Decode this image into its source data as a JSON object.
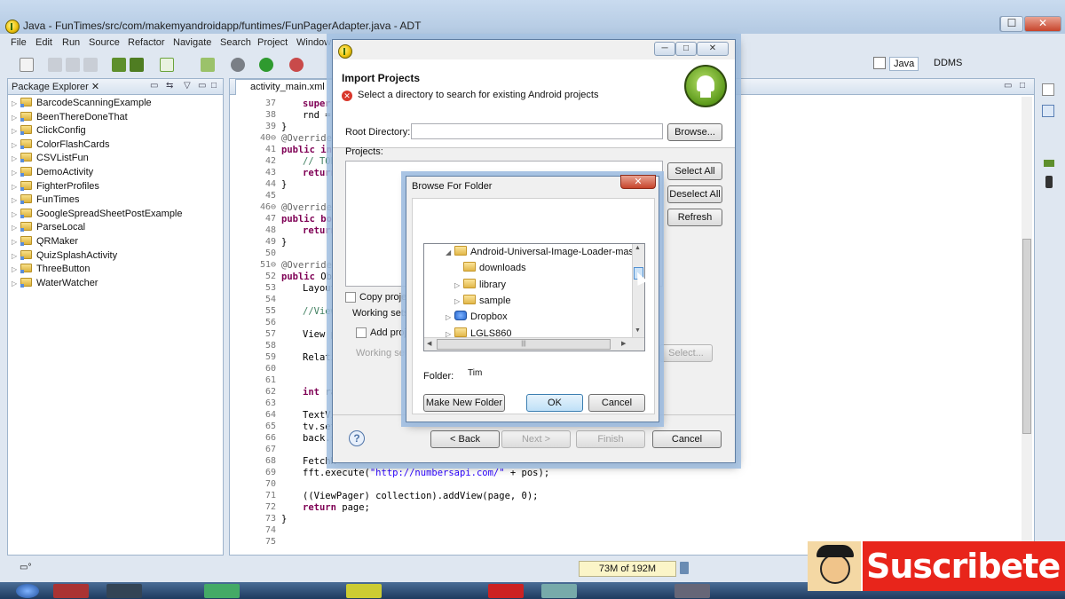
{
  "window": {
    "title": "Java - FunTimes/src/com/makemyandroidapp/funtimes/FunPagerAdapter.java - ADT",
    "controls": [
      "─",
      "☐",
      "✕"
    ]
  },
  "menu": [
    "File",
    "Edit",
    "Run",
    "Source",
    "Refactor",
    "Navigate",
    "Search",
    "Project",
    "Window"
  ],
  "perspectives": {
    "java": "Java",
    "ddms": "DDMS"
  },
  "package_explorer": {
    "title": "Package Explorer ✕",
    "projects": [
      "BarcodeScanningExample",
      "BeenThereDoneThat",
      "ClickConfig",
      "ColorFlashCards",
      "CSVListFun",
      "DemoActivity",
      "FighterProfiles",
      "FunTimes",
      "GoogleSpreadSheetPostExample",
      "ParseLocal",
      "QRMaker",
      "QuizSplashActivity",
      "ThreeButton",
      "WaterWatcher"
    ]
  },
  "editor": {
    "tab": "activity_main.xml",
    "line_numbers": [
      "37",
      "38",
      "39",
      "40⊖",
      "41",
      "42",
      "43",
      "44",
      "45",
      "46⊖",
      "47",
      "48",
      "49",
      "50",
      "51⊖",
      "52",
      "53",
      "54",
      "55",
      "56",
      "57",
      "58",
      "59",
      "60",
      "61",
      "62",
      "63",
      "64",
      "65",
      "66",
      "67",
      "68",
      "69",
      "70",
      "71",
      "72",
      "73",
      "74",
      "75"
    ],
    "lines": {
      "l37": "super",
      "l38": "rnd =",
      "l39": "}",
      "l40": "@Override",
      "l41a": "public",
      "l41b": " int",
      "l42": "// TOD",
      "l43": "return",
      "l44": "}",
      "l46": "@Override",
      "l47a": "public",
      "l47b": " boo",
      "l48": "return",
      "l49": "}",
      "l51": "@Override",
      "l52a": "public",
      "l52b": " Ob",
      "l53": "Layout",
      "l55": "//View",
      "l57": "View p",
      "l59": "Relati",
      "l62a": "int",
      "l62b": " ra",
      "l64": "TextVi",
      "l65": "tv.set",
      "l66": "back.s",
      "l68": "FetchN",
      "l69a": "fft.execute(",
      "l69b": "\"http://numbersapi.com/\"",
      "l69c": " + pos);",
      "l71": "((ViewPager) collection).addView(page, 0);",
      "l72a": "return",
      "l72b": " page;",
      "l73": "}"
    }
  },
  "status": {
    "heap": "73M of 192M"
  },
  "import_dialog": {
    "title": "Import Projects",
    "message": "Select a directory to search for existing Android projects",
    "root_label": "Root Directory:",
    "browse": "Browse...",
    "projects_label": "Projects:",
    "select_all": "Select All",
    "deselect_all": "Deselect All",
    "refresh": "Refresh",
    "copy_label": "Copy proje",
    "working_sets_label": "Working sets",
    "add_label": "Add proj",
    "working_sets_field": "Working set",
    "select_button": "Select...",
    "help": "?",
    "back": "< Back",
    "next": "Next >",
    "finish": "Finish",
    "cancel": "Cancel"
  },
  "browse_dialog": {
    "title": "Browse For Folder",
    "close": "✕",
    "tree": [
      {
        "label": "Android-Universal-Image-Loader-maste",
        "indent": 1,
        "expanded": true
      },
      {
        "label": "downloads",
        "indent": 2,
        "expanded": null
      },
      {
        "label": "library",
        "indent": 2,
        "expanded": false
      },
      {
        "label": "sample",
        "indent": 2,
        "expanded": false
      },
      {
        "label": "Dropbox",
        "indent": 1,
        "expanded": false
      },
      {
        "label": "LGLS860",
        "indent": 1,
        "expanded": false
      }
    ],
    "folder_label": "Folder:",
    "folder_value": "Tim",
    "make_new_folder": "Make New Folder",
    "ok": "OK",
    "cancel": "Cancel"
  },
  "banner": {
    "text": "Suscribete"
  }
}
